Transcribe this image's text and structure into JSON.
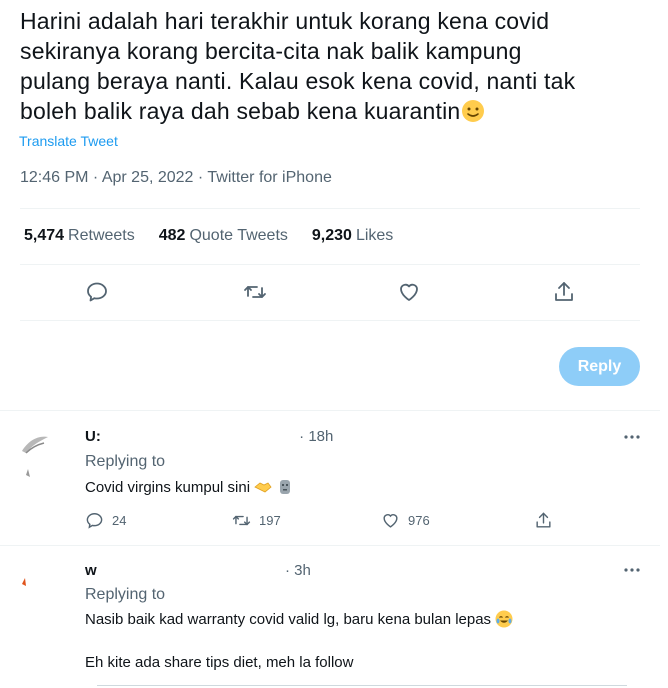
{
  "tweet": {
    "line1": "Harini adalah hari terakhir untuk korang kena covid",
    "line2": "sekiranya korang bercita-cita nak balik kampung",
    "line3": "pulang beraya nanti. Kalau esok kena covid, nanti tak",
    "line4": "boleh balik raya dah sebab kena kuarantin",
    "translate_label": "Translate Tweet",
    "meta": "12:46 PM · Apr 25, 2022 · Twitter for iPhone"
  },
  "stats": {
    "retweets_count": "5,474",
    "retweets_label": "Retweets",
    "quotes_count": "482",
    "quotes_label": "Quote Tweets",
    "likes_count": "9,230",
    "likes_label": "Likes"
  },
  "compose": {
    "reply_button": "Reply"
  },
  "replies": [
    {
      "name": "U:",
      "time": "· 18h",
      "replying_label": "Replying to",
      "text": "Covid virgins kumpul sini",
      "reply_count": "24",
      "retweet_count": "197",
      "like_count": "976"
    },
    {
      "name": "w",
      "time": "· 3h",
      "replying_label": "Replying to",
      "text_line1": "Nasib baik kad warranty covid valid lg, baru kena bulan lepas",
      "text_line2": "Eh kite ada share tips diet, meh la follow"
    }
  ],
  "colors": {
    "accent": "#1d9bf0",
    "reply_button_disabled": "#8ecdf8",
    "secondary_text": "#536471",
    "divider": "#eff3f4"
  }
}
